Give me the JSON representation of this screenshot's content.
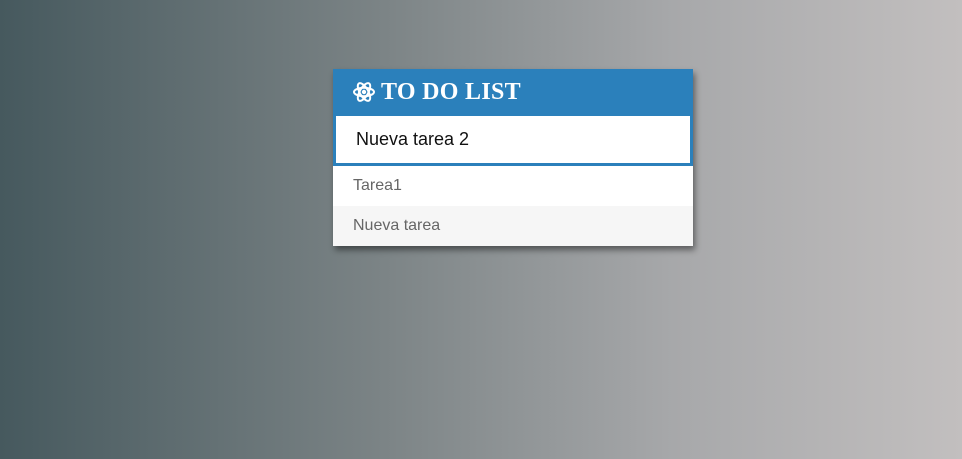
{
  "app": {
    "title": "TO DO LIST",
    "title_icon": "atom-icon"
  },
  "input": {
    "value": "Nueva tarea 2",
    "placeholder": ""
  },
  "tasks": [
    {
      "label": "Tarea1"
    },
    {
      "label": "Nueva tarea"
    }
  ],
  "colors": {
    "accent": "#2b80bb",
    "item_text": "#666666",
    "alt_row": "#f6f6f6"
  }
}
